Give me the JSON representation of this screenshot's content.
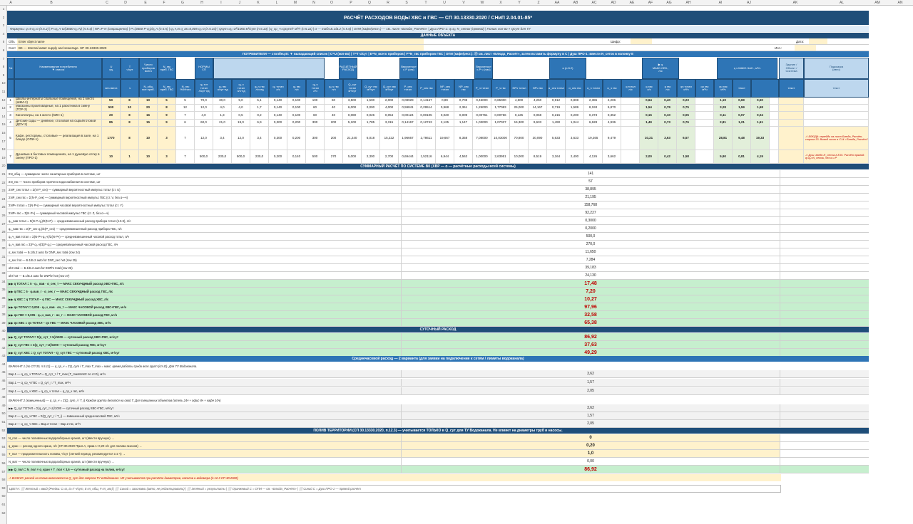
{
  "columns": [
    "A",
    "B",
    "C",
    "D",
    "E",
    "F",
    "G",
    "H",
    "I",
    "J",
    "K",
    "L",
    "M",
    "N",
    "O",
    "P",
    "Q",
    "R",
    "S",
    "T",
    "U",
    "V",
    "W",
    "X",
    "Y",
    "Z",
    "AA",
    "AB",
    "AC",
    "AD",
    "AE",
    "AF",
    "AG",
    "AH",
    "AI",
    "AJ",
    "AK",
    "AL",
    "AM",
    "AN"
  ],
  "rows": [
    "1",
    "2",
    "3",
    "4",
    "5",
    "6",
    "7",
    "8",
    "9",
    "10",
    "11",
    "12",
    "13",
    "14",
    "15",
    "16",
    "17",
    "18",
    "19",
    "20",
    "21",
    "22",
    "23",
    "24",
    "25",
    "26",
    "27",
    "28",
    "29",
    "30",
    "31",
    "32",
    "33",
    "34",
    "35",
    "36",
    "37",
    "38",
    "39",
    "40",
    "41",
    "42",
    "43",
    "44",
    "45",
    "46",
    "47",
    "48",
    "49",
    "50",
    "51",
    "52",
    "53",
    "54",
    "55",
    "56",
    "57",
    "58",
    "59",
    "60",
    "61",
    "62"
  ],
  "title": "РАСЧЁТ РАСХОДОВ ВОДЫ  ХВС и ГВС  —  СП 30.13330.2020 / СНиП 2.04.01-85*",
  "formulas": "Формулы: q=5·q₀·α (п.5.2) | P=q₀,ч·U/(3600·q₀·N) (п.5.4) | NP=P·N (сокращенно) | P=(3600·P·q₀)/q₀,ч (п.5.5) | q₀,ч,т  q_вк=0,005·q₀·α (п.5.10) | Qсут=q₀·U²/1000 м³/сут (п.5.13) | q_ср_ч=Qсут/T м³/ч (п.5.11) | α — табл.Б.1/Б.2 (п.5.6) | ОПИ (кафе/рест.) — см. лист «Блюда_Расчёт» | Душ ПРО-1: q=q₀·N_сеток (прямой) | Полив: кол-во × Qсут для ТУ",
  "object_section": "ДАННЫЕ ОБЪЕКТА",
  "object": {
    "obj_label": "Объ",
    "obj_value": "Enter object name",
    "sys_label": "Сист",
    "sys_value": "ВК — Internal water supply and sewerage. SP 30.13330.2020",
    "code_label": "Шифр:",
    "date_label": "Дата:",
    "ver_label": "Исп.:"
  },
  "consumer_band": "ПОТРЕБИТЕЛИ — столбец B: ▼ выпадающий список | C=U (кол-во) | T=T ч/сут | E=N_всего приборов | F=N_гвс приборов ГВС | ОПИ (кафе/рест.): Ⓐ см. лист «Блюда_Расчёт», затем вставить формулу в C | Душ ПРО-1: ввести N_сеток в колонку E",
  "headers": {
    "num": "№",
    "name": "Наименование потребителя\n▼ список",
    "u": "U\nед.",
    "t": "T\nч/сут",
    "n_total": "Число\nприборов\nвсего",
    "n_gvs": "N_гвс\nприб. ГВС",
    "norm_group": "НОРМЫ\nСП",
    "q0_tot": "q₀ тот\nл/сут·ед",
    "q0_hr": "q₀,ч\nтот л/ч",
    "calc_group": "РАСЧЁТНЫЙ\nРАСХОД",
    "prob_group": "Вероятност\nь P (сек)",
    "prob_hr": "Вероятност\nь P ч (час)",
    "alpha": "α (п.5.2)",
    "q_sec_group": "▶ q\nМАКС.СЕК.,\nл/с",
    "q_hr_group": "q ч МАКС.ЧАС., м³/ч",
    "building": "Здание /\nОбъект /\nСистема",
    "hint": "Подсказка\n(авто)"
  },
  "subheaders": [
    "чел./мест.",
    "ч",
    "N_общ\nвсе приб.",
    "N_гвс\nприб. ГВС",
    "N_гвс\n%/Итого",
    "q₀ тот\nтотал\nл/сут·ед",
    "q₀ гвс\nл/сут·ед",
    "q₀,ч\nтотал\nл/ч·ед",
    "q₀,ч гвс\nл/ч·ед",
    "q₀ тотал\nл/с",
    "q₀ гвс\nл/с",
    "q₀,ч\nтотал\nл/ч",
    "q₀,ч гвс\nл/ч",
    "Q_сут тотал\nм³/сут",
    "Q_сут гвс\nм³/сут",
    "Q_сут хвс\nм³/сут",
    "P_сек тотал",
    "P_сек гвс",
    "NP_сек\nтотал",
    "NP_сек\nгвс",
    "P_ч тотал",
    "P_ч гвс",
    "NPч тотал",
    "NPч гвс",
    "α_сек тотал",
    "α_сек гвс",
    "α_ч тотал",
    "α_ч гвс",
    "q тотал\nл/с",
    "q хвс\nл/с",
    "q гвс\nл/с",
    "qч тотал\nм³/ч",
    "qч гвс\nм³/ч",
    "qч хвс\nм³/ч",
    "текст",
    "текст"
  ],
  "consumers": [
    {
      "row": "10",
      "num": "1",
      "name": "Школы-интернаты спальные помещения, на 1 место (ШКИ-2)",
      "u": "50",
      "t": "8",
      "n": "10",
      "ng": "5",
      "pct": "5",
      "a": "70,0",
      "b": "30,0",
      "c": "9,0",
      "d": "5,1",
      "e": "0,140",
      "f": "0,100",
      "g": "100",
      "h": "60",
      "i": "3,500",
      "j": "1,500",
      "k": "2,000",
      "l": "0,08929",
      "m": "0,14167",
      "n2": "0,89",
      "o": "0,708",
      "p": "0,45000",
      "q": "0,65000",
      "r": "4,500",
      "s": "4,250",
      "t2": "0,912",
      "u2": "0,808",
      "v": "2,386",
      "w": "2,206",
      "x": "0,64",
      "y": "0,40",
      "z": "0,23",
      "aa": "1,19",
      "ab": "0,69",
      "ac": "0,50",
      "note": ""
    },
    {
      "row": "11",
      "num": "2",
      "name": "Магазины промтоварные, на 1 работника в смену (ТОР-2)",
      "u": "500",
      "t": "10",
      "n": "20",
      "ng": "8",
      "pct": "12",
      "a": "12,0",
      "b": "4,0",
      "c": "4,0",
      "d": "1,7",
      "e": "0,140",
      "f": "0,100",
      "g": "60",
      "h": "40",
      "i": "6,000",
      "j": "2,000",
      "k": "4,000",
      "l": "0,59841",
      "m": "0,29514",
      "n2": "0,968",
      "o": "2,361",
      "p": "1,25000",
      "q": "1,77083",
      "r": "25,000",
      "s": "14,167",
      "t2": "0,719",
      "u2": "1,589",
      "v": "8,193",
      "w": "5,870",
      "x": "1,54",
      "y": "0,79",
      "z": "0,75",
      "aa": "3,28",
      "ab": "1,59",
      "ac": "1,68",
      "note": ""
    },
    {
      "row": "12",
      "num": "3",
      "name": "Кинотеатры, на 1 место (КИН-1)",
      "u": "20",
      "t": "8",
      "n": "16",
      "ng": "9",
      "pct": "7",
      "a": "4,0",
      "b": "1,3",
      "c": "0,5",
      "d": "0,2",
      "e": "0,140",
      "f": "0,100",
      "g": "60",
      "h": "40",
      "i": "0,080",
      "j": "0,026",
      "k": "0,054",
      "l": "0,00124",
      "m": "0,00105",
      "n2": "0,020",
      "o": "0,009",
      "p": "0,00761",
      "q": "0,00756",
      "r": "0,125",
      "s": "0,068",
      "t2": "0,215",
      "u2": "0,200",
      "v": "0,373",
      "w": "0,352",
      "x": "0,15",
      "y": "0,10",
      "z": "0,05",
      "aa": "0,11",
      "ab": "0,07",
      "ac": "0,04",
      "note": ""
    },
    {
      "row": "13",
      "num": "4",
      "name": "Детские сады — дневное, столовой на сырьё/готовой (ДОУ-2)",
      "u": "85",
      "t": "8",
      "n": "15",
      "ng": "9",
      "pct": "6",
      "a": "60,0",
      "b": "21,0",
      "c": "19,0",
      "d": "6,9",
      "e": "0,300",
      "f": "0,200",
      "g": "300",
      "h": "200",
      "i": "5,100",
      "j": "1,785",
      "k": "3,315",
      "l": "0,14167",
      "m": "0,12743",
      "n2": "2,125",
      "o": "1,147",
      "p": "1,03000",
      "q": "1,07037",
      "r": "15,300",
      "s": "9,633",
      "t2": "1,490",
      "u2": "1,044",
      "v": "6,628",
      "w": "4,936",
      "x": "1,49",
      "y": "0,73",
      "z": "0,76",
      "aa": "2,81",
      "ab": "1,21",
      "ac": "1,61",
      "note": ""
    },
    {
      "row": "14",
      "num": "5",
      "name": "Кафе, рестораны, столовые — реализация в зале, на 1 блюдо (ОПИ-1)",
      "u": "1770",
      "t": "8",
      "n": "10",
      "ng": "3",
      "pct": "7",
      "a": "12,0",
      "b": "3,4",
      "c": "12,0",
      "d": "3,4",
      "e": "0,300",
      "f": "0,200",
      "g": "300",
      "h": "200",
      "i": "21,240",
      "j": "6,018",
      "k": "15,222",
      "l": "1,96667",
      "m": "2,78611",
      "n2": "19,667",
      "o": "8,358",
      "p": "7,08000",
      "q": "10,03000",
      "r": "70,800",
      "s": "30,090",
      "t2": "5,633",
      "u2": "3,633",
      "v": "19,265",
      "w": "9,479",
      "x": "10,21",
      "y": "3,63",
      "z": "6,57",
      "aa": "28,81",
      "ab": "9,48",
      "ac": "19,33",
      "note": "⚠ БЛЮДА: перейди на лист Блюда_Расчёт, строка 33. Вывод число в C14 ='Блюда_Расчёт'!"
    },
    {
      "row": "15",
      "num": "7",
      "name": "Душевые в бытовых помещениях, на 1 душевую сетку в смену (ПРО-1)",
      "u": "10",
      "t": "1",
      "n": "10",
      "ng": "3",
      "pct": "7",
      "a": "500,0",
      "b": "230,0",
      "c": "500,0",
      "d": "230,0",
      "e": "0,200",
      "f": "0,140",
      "g": "500",
      "h": "270",
      "i": "5,000",
      "j": "2,300",
      "k": "2,700",
      "l": "0,69444",
      "m": "1,52116",
      "n2": "6,944",
      "o": "4,563",
      "p": "1,00000",
      "q": "2,63951",
      "r": "10,000",
      "s": "8,519",
      "t2": "3,164",
      "u2": "2,400",
      "v": "4,126",
      "w": "3,662",
      "x": "2,00",
      "y": "0,42",
      "z": "1,58",
      "aa": "5,90",
      "ab": "0,81",
      "ac": "4,19",
      "note": "⚠ Душ: введи N_сеток в E15. Расчёт прямой: q=q₀×N_сеток, без α и P"
    }
  ],
  "summary_section": "СУММАРНЫЙ РАСЧЁТ ПО СИСТЕМЕ ВК (ХВР — о — расчётные расходы всей системы)",
  "summary": [
    {
      "row": "17",
      "label": "ΣN_общ — суммарное число санитарных приборов в системе, шт",
      "value": "141",
      "style": ""
    },
    {
      "row": "18",
      "label": "ΣN_гвс — число приборов горячего водоснабжения в системе, шт",
      "value": "57",
      "style": ""
    },
    {
      "row": "19",
      "label": "ΣNP_сек тотал = Σ(N·P_сек) — суммарный вероятностный импульс тотал (ст. U)",
      "value": "38,895",
      "style": ""
    },
    {
      "row": "20",
      "label": "ΣNP_сек гвс = Σ(N·P_сек) — суммарный вероятностный импульс ГВС (ст. V, без α—ч)",
      "value": "21,195",
      "style": ""
    },
    {
      "row": "21",
      "label": "ΣNPч тотал = Σ(N·Pч) — суммарный часовой вероятностный импульс тотал (ст. Y)",
      "value": "158,768",
      "style": ""
    },
    {
      "row": "22",
      "label": "ΣNPч гвс = Σ(N·Pч) — суммарный часовой импульс ГВС (ст. Z, без α—ч)",
      "value": "92,227",
      "style": ""
    },
    {
      "row": "23",
      "label": "q₀_вав тотал = Σ(N·P·q₀)/Σ(N·P) — средневзвешенный расход прибора тотал (п.5.9), л/с",
      "value": "0,3000",
      "style": ""
    },
    {
      "row": "24",
      "label": "q₀_вав гвс = Σ(P_сек·q₀)/Σ(P_сек) — средневзвешенный расход прибора ГВС, л/с",
      "value": "0,2000",
      "style": ""
    },
    {
      "row": "25",
      "label": "q₀,ч_вав тотал = Σ(N·Pч·q₀,ч)/Σ(N·Pч) — средневзвешенный часовой расход тотал, л/ч",
      "value": "500,0",
      "style": ""
    },
    {
      "row": "26",
      "label": "q₀,ч_вав гвс = Σ(P·q₀,ч)/Σ(P·q₀) — средневзвешенный часовой расход ГВС, л/ч",
      "value": "270,0",
      "style": ""
    },
    {
      "row": "27",
      "label": "α_sec total — Б.1/Б.2 auto for ΣNP_sec total (row 24)",
      "value": "11,650",
      "style": ""
    },
    {
      "row": "28",
      "label": "α_sec hot — Б.1/Б.2 auto for ΣNP_sec hot (row 25)",
      "value": "7,284",
      "style": ""
    },
    {
      "row": "29",
      "label": "αhr total — Б.1/Б.2 auto for ΣNPhr total (row 26)",
      "value": "39,183",
      "style": ""
    },
    {
      "row": "30",
      "label": "αhr hot — Б.1/Б.2 auto for ΣNPhr hot (row 27)",
      "value": "24,130",
      "style": ""
    },
    {
      "row": "31",
      "label": "▶▶  q ТОТАЛ = 5 · q₀_вав · α_сек_т — МАКС СЕКУНДНЫЙ расход ХВС+ГВС, л/с",
      "value": "17,48",
      "style": "green"
    },
    {
      "row": "32",
      "label": "▶▶  q ГВС = 5 · q₀вав_г · α_сек_г — МАКС СЕКУНДНЫЙ расход ГВС, л/с",
      "value": "7,20",
      "style": "green"
    },
    {
      "row": "33",
      "label": "▶▶  q ХВС = q ТОТАЛ − q ГВС — МАКС СЕКУНДНЫЙ расход ХВС, л/с",
      "value": "10,27",
      "style": "green"
    },
    {
      "row": "34",
      "label": "▶▶  qч ТОТАЛ = 0,005 · q₀,ч_вав · αч_т — МАКС ЧАСОВОЙ расход ХВС+ГВС, м³/ч",
      "value": "97,96",
      "style": "green"
    },
    {
      "row": "35",
      "label": "▶▶  qч ГВС = 0,005 · q₀,ч_вав_г · αч_г — МАКС ЧАСОВОЙ расход ГВС, м³/ч",
      "value": "32,58",
      "style": "green"
    },
    {
      "row": "36",
      "label": "▶▶  qч ХВС = qч ТОТАЛ − qч ГВС — МАКС ЧАСОВОЙ расход ХВС, м³/ч",
      "value": "65,38",
      "style": "green"
    }
  ],
  "daily_section": "СУТОЧНЫЙ РАСХОД",
  "daily": [
    {
      "row": "38",
      "label": "▶▶  Q_сут ТОТАЛ = Σ(q_сут_т·U)/1000 — суточный расход ХВС+ГВС, м³/сут",
      "value": "86,92",
      "style": "green"
    },
    {
      "row": "39",
      "label": "▶▶  Q_сут ГВС = Σ(q_сут_г·U)/1000 — суточный расход ГВС, м³/сут",
      "value": "37,63",
      "style": "green"
    },
    {
      "row": "40",
      "label": "▶▶  Q_сут ХВС = Q_сут ТОТАЛ − Q_сут ГВС — суточный расход ХВС, м³/сут",
      "value": "49,29",
      "style": "green"
    }
  ],
  "avg_section": "Среднечасовой расход — 2 варианта (для заявки на подключение к сетям / лимиты водоканала)",
  "avg_v1_label": "ВАРИАНТ 1 (по СП 30, п.5.11) — q_ср_ч = ΣQ_сут / T_max  T_max = макс. время работы среди всех групп (ст.D). Для ТУ Водоканала.",
  "avg": [
    {
      "row": "43",
      "label": "Вар.1 — q_ср_ч ТОТАЛ = Q_сут_т / T_max (T_maxМАКС по ст.D), м³/ч",
      "value": "3,62",
      "style": "gray"
    },
    {
      "row": "44",
      "label": "Вар.1 — q_ср_ч ГВС = Q_сут_г / T_max, м³/ч",
      "value": "1,57",
      "style": "gray"
    },
    {
      "row": "45",
      "label": "Вар.1 — q_ср_ч ХВС = q_ср_ч тотал − q_ср_ч гвс, м³/ч",
      "value": "2,05",
      "style": "gray"
    }
  ],
  "avg_v2_label": "ВАРИАНТ 2 (взвешенный) — q_ср_ч = Σ(Q_сут_i / T_i)   Каждая группа делится на свой T. Для смешанных объектов (отель 24ч + офис 8ч + кафе 10ч)",
  "avg2": [
    {
      "row": "48",
      "label": "▶▶  Q_сут ТОТАЛ = Σ(q_сут_т·U)/1000 — суточный расход ХВС+ГВС, м³/сут",
      "value": "3,62",
      "style": "gray"
    },
    {
      "row": "49",
      "label": "Вар.2 — q_ср_ч ГВС = Σ(Q_сут_г / T_i) — взвешенный среднечасовой ГВС, м³/ч",
      "value": "1,57",
      "style": "gray"
    },
    {
      "row": "50",
      "label": "Вар.2 — q_ср_ч ХВС = Вар.2 тотал − Вар.2 гвс, м³/ч",
      "value": "2,05",
      "style": "gray"
    }
  ],
  "irrig_section": "ПОЛИВ ТЕРРИТОРИИ (СП 30.13330.2020, п.12.3) — учитывается ТОЛЬКО в Q_сут для ТУ Водоканала. Не влияет на диаметры труб и насосы.",
  "irrig": [
    {
      "row": "52",
      "label": "N_пол — число поливочных водоразборных кранов, шт  (ввести вручную) →",
      "value": "0",
      "style": "yellow"
    },
    {
      "row": "53",
      "label": "q_кран — расход одного крана, л/с  (СП 30.2020 Прил.А, прим.1: 0,20 л/с для полива газонов) →",
      "value": "0,20",
      "style": "yellow"
    },
    {
      "row": "54",
      "label": "T_пол — продолжительность полива, ч/сут  (летний период, рекомендуется 1-2 ч) →",
      "value": "1,0",
      "style": "yellow"
    },
    {
      "row": "55",
      "label": "N_мат — число поливочных водоразборных кранов, шт  (ввести вручную) →",
      "value": "0,00",
      "style": ""
    },
    {
      "row": "56",
      "label": "▶▶  Q_пол = N_пол × q_кран × T_пол × 3,6 — суточный расход на полив, м³/сут",
      "value": "86,92",
      "style": "green"
    }
  ],
  "note": "⚠ ВАЖНО: расход на полив включается в Q_сут для запроса ТУ в Водоканал. НЕ учитывается при расчёте диаметров, насосов и водомера (п.12.3 СП 30.2020)",
  "legend": "ЦВЕТА:  ⬜ Жёлтый = ввод (Ячейки: C=U, D=T ч/сут, E=N_общ, F=N_гвс)  |  ⬜ Синий = заголовки (авто, не редактировать)  |  ⬜ Зелёный = результаты  |  ⬜ Оранжевый С = ОПИ — см. «Блюда_Расчёт»  |  ⬜ Синий С = Душ ПРО-1 — прямой расчёт"
}
